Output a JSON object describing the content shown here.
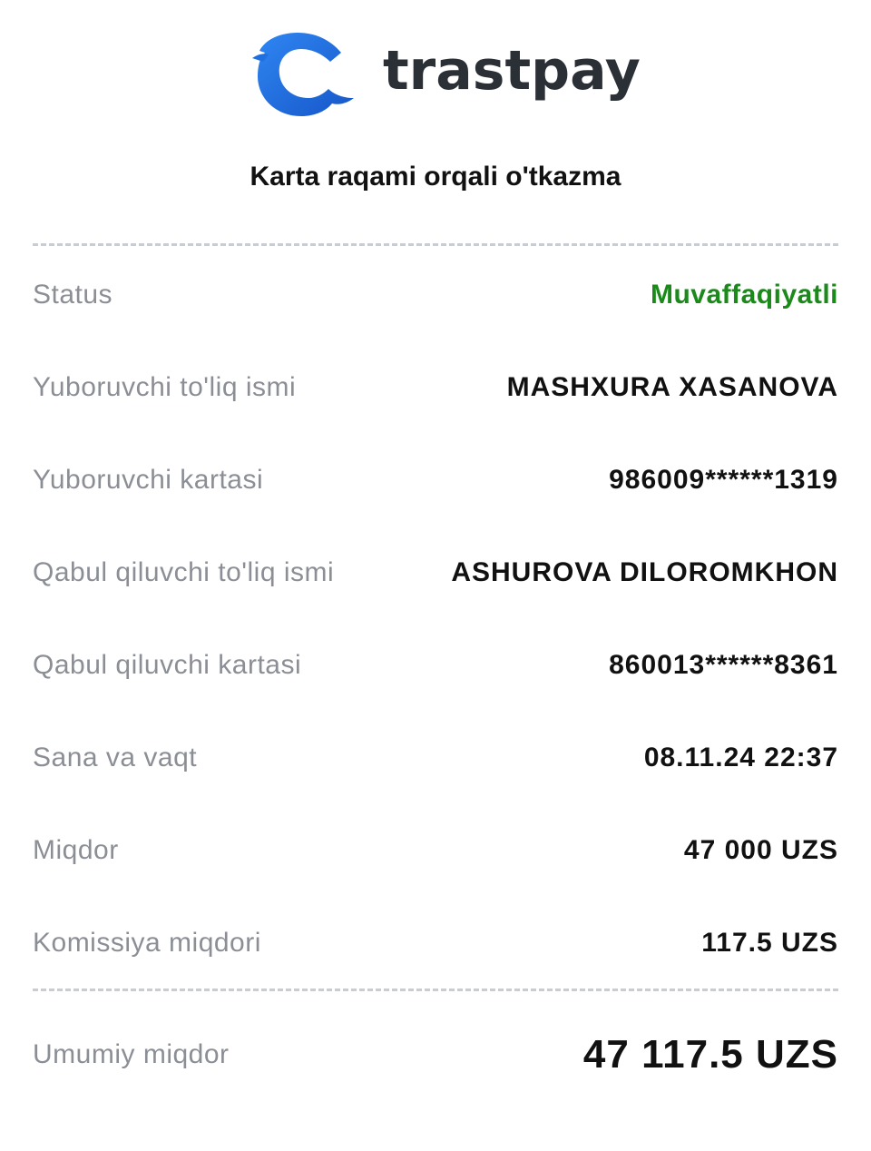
{
  "brand": {
    "name": "trastpay",
    "logo_icon": "dolphin-logo-icon",
    "colors": {
      "logo_blue": "#1f6fe0",
      "text_dark": "#2b2f36"
    }
  },
  "receipt": {
    "title": "Karta raqami orqali o'tkazma",
    "rows": [
      {
        "label": "Status",
        "value": "Muvaffaqiyatli"
      },
      {
        "label": "Yuboruvchi to'liq ismi",
        "value": "MASHXURA XASANOVA"
      },
      {
        "label": "Yuboruvchi kartasi",
        "value": "986009******1319"
      },
      {
        "label": "Qabul qiluvchi to'liq ismi",
        "value": "ASHUROVA DILOROMKHON"
      },
      {
        "label": "Qabul qiluvchi kartasi",
        "value": "860013******8361"
      },
      {
        "label": "Sana va vaqt",
        "value": "08.11.24 22:37"
      },
      {
        "label": "Miqdor",
        "value": "47 000 UZS"
      },
      {
        "label": "Komissiya miqdori",
        "value": "117.5 UZS"
      }
    ],
    "total": {
      "label": "Umumiy miqdor",
      "value": "47 117.5 UZS"
    },
    "status_color": "#1b8a1b"
  }
}
